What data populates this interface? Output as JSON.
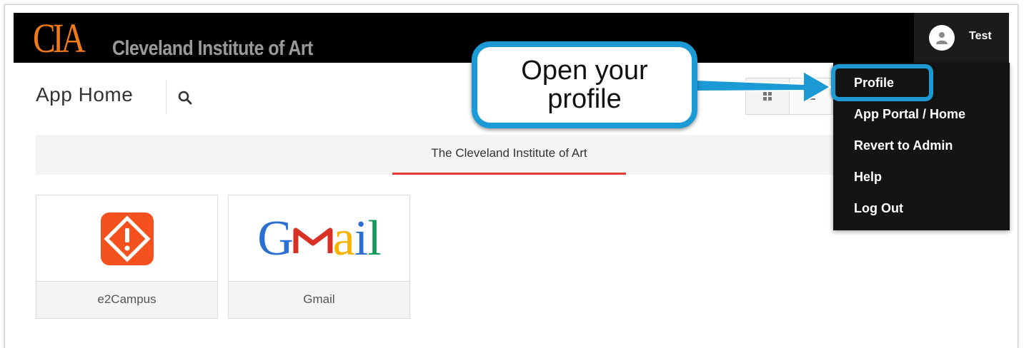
{
  "brand": {
    "logo_mark": "CIA",
    "logo_text": "Cleveland Institute of Art",
    "logo_color": "#f07a18"
  },
  "user": {
    "name": "Test",
    "avatar_icon": "user-icon"
  },
  "header": {
    "title": "App Home",
    "search_icon": "search-icon"
  },
  "view_toggle": {
    "grid_icon": "grid-icon",
    "list_icon": "list-icon"
  },
  "tabs": [
    {
      "label": "The Cleveland Institute of Art",
      "active": true
    }
  ],
  "apps": [
    {
      "label": "e2Campus",
      "icon": "e2campus-alert-icon"
    },
    {
      "label": "Gmail",
      "icon": "gmail-logo"
    }
  ],
  "dropdown_menu": {
    "items": [
      {
        "label": "Profile",
        "highlighted": true
      },
      {
        "label": "App Portal / Home"
      },
      {
        "label": "Revert to Admin"
      },
      {
        "label": "Help"
      },
      {
        "label": "Log Out"
      }
    ]
  },
  "callout": {
    "text": "Open your profile",
    "color": "#1c9ad6"
  },
  "colors": {
    "active_tab_underline": "#e53935",
    "e2campus_orange": "#f4511e"
  }
}
